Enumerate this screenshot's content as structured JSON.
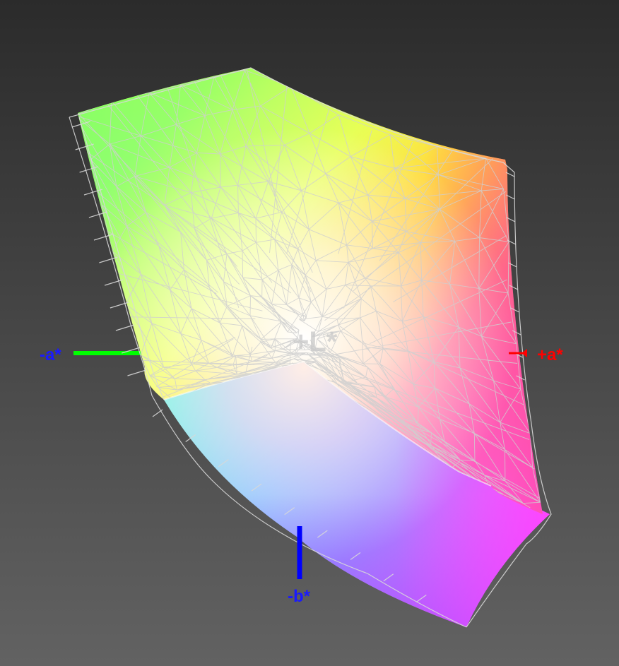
{
  "axes": {
    "minus_a": {
      "label": "-a*",
      "color": "#1a1aff",
      "line_color": "#00ff00"
    },
    "plus_a": {
      "label": "+a*",
      "color": "#ff0000",
      "line_color": "#ff0000"
    },
    "minus_b": {
      "label": "-b*",
      "color": "#1a1aff",
      "line_color": "#0000ff"
    },
    "plus_l": {
      "label": "+L*",
      "color": "#c8c8c8"
    }
  },
  "colors": {
    "background_top": "#2b2b2b",
    "background_bottom": "#616161",
    "wireframe": "#c8c8c8"
  }
}
